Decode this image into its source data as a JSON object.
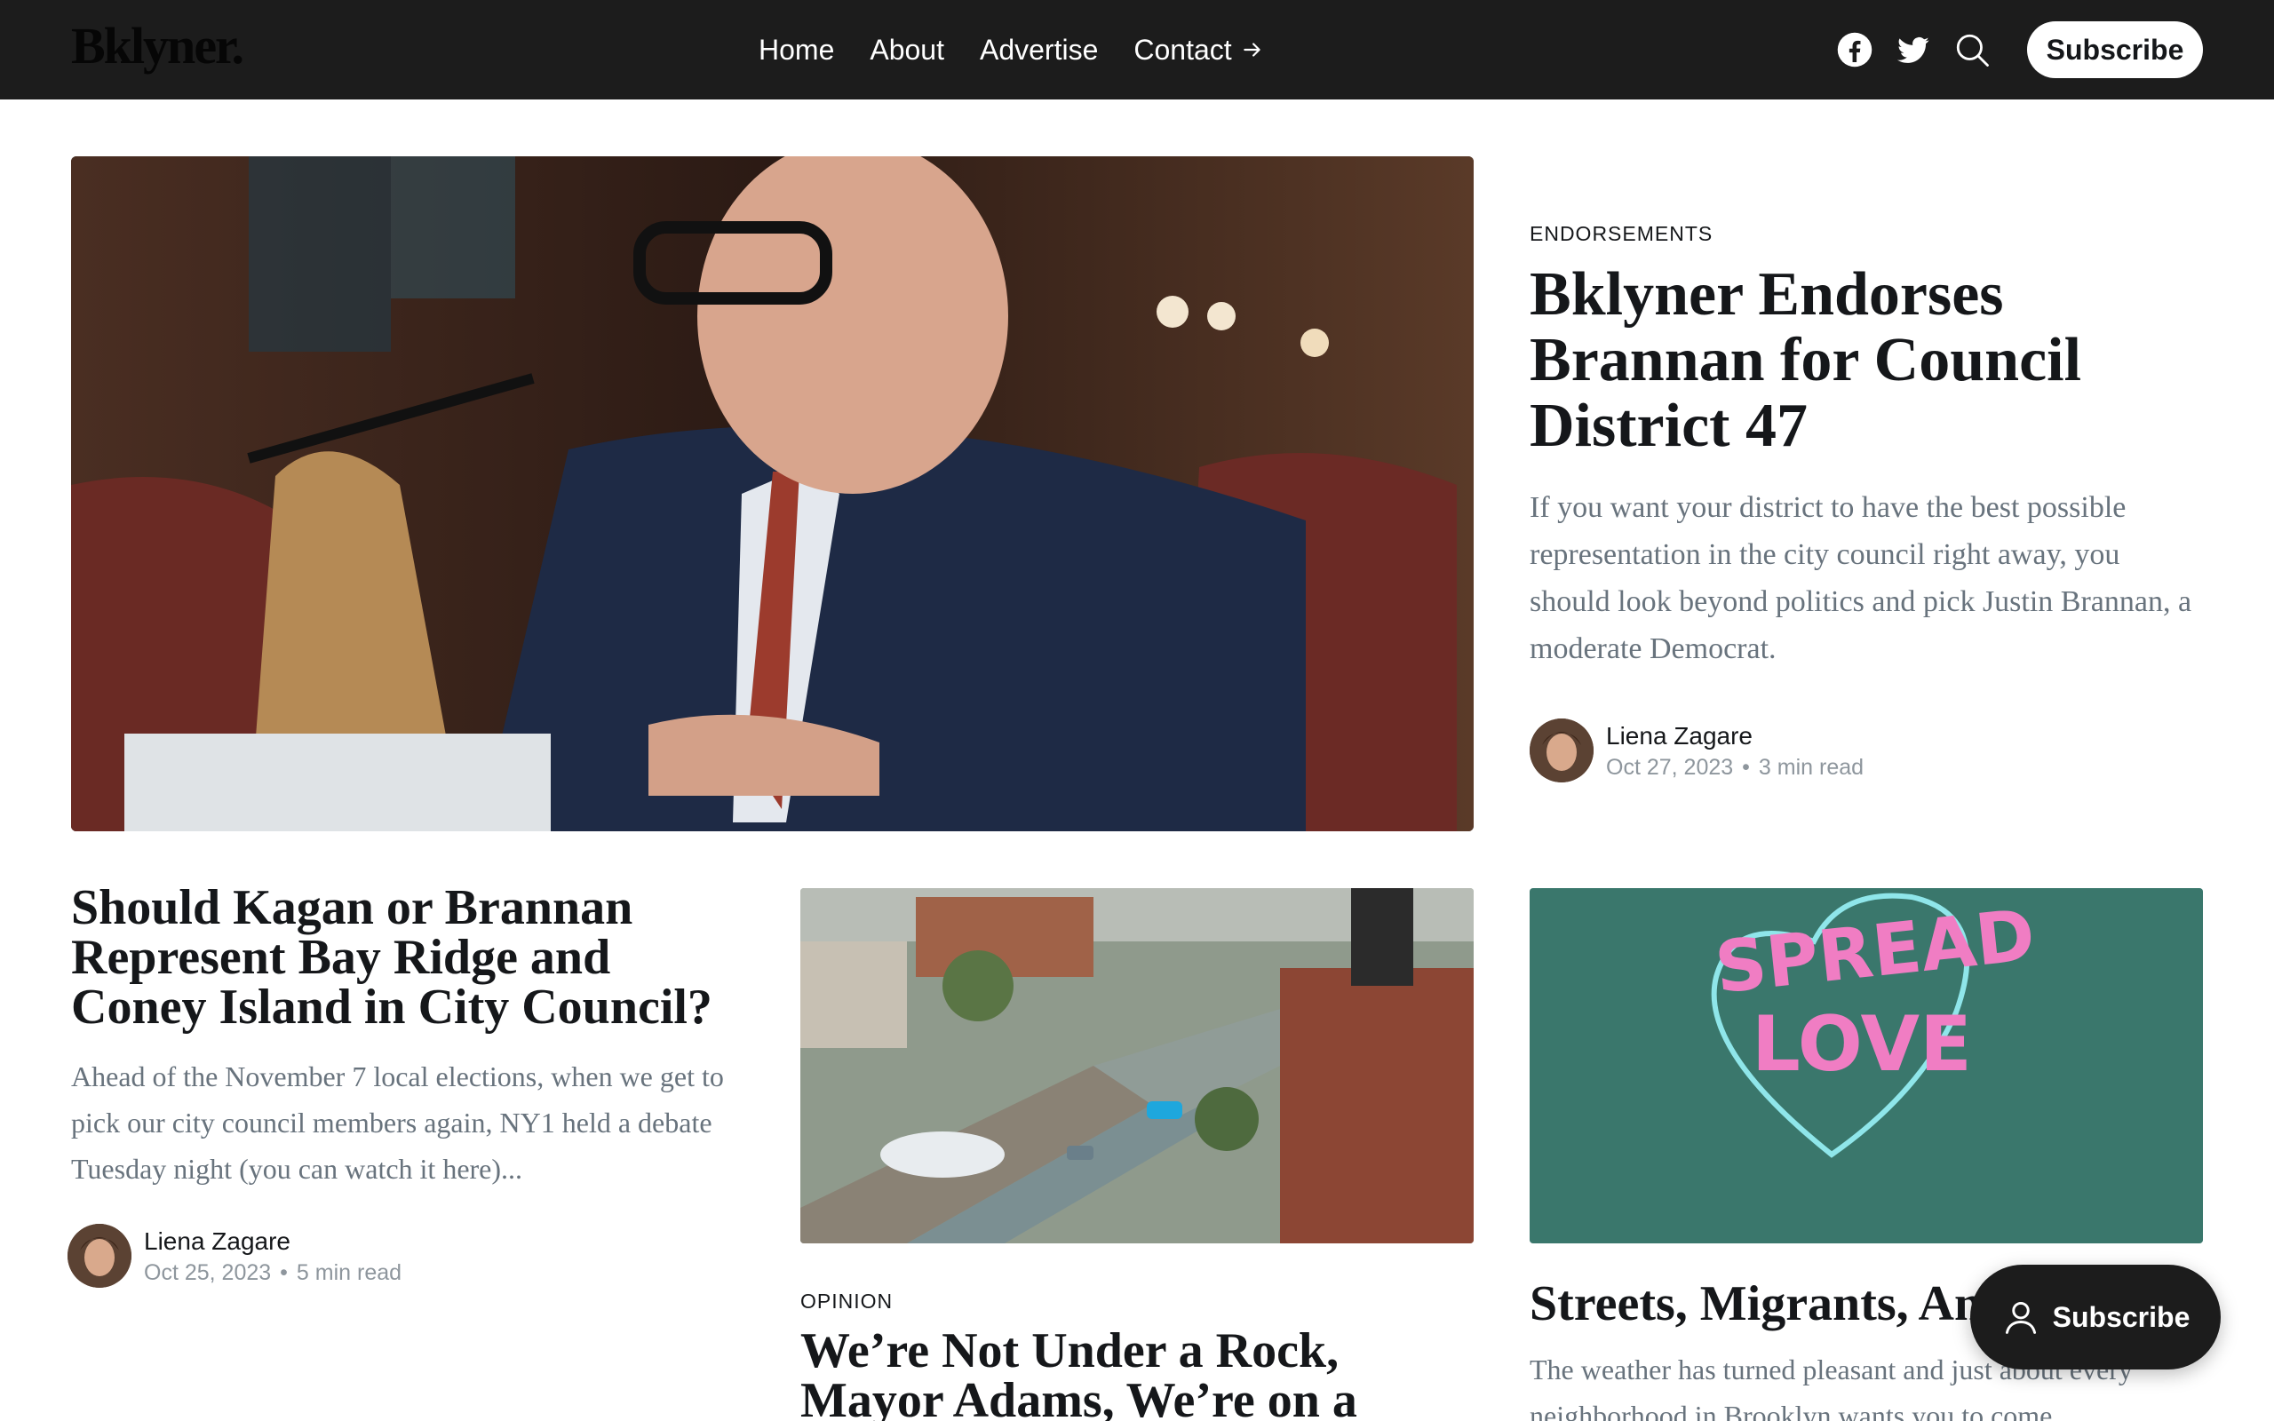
{
  "site": {
    "logo": "Bklyner."
  },
  "nav": [
    {
      "label": "Home"
    },
    {
      "label": "About"
    },
    {
      "label": "Advertise"
    },
    {
      "label": "Contact"
    }
  ],
  "header": {
    "subscribe_label": "Subscribe"
  },
  "icons": {
    "facebook": "facebook-icon",
    "twitter": "twitter-icon",
    "search": "search-icon",
    "arrow": "arrow-right-icon",
    "user": "user-icon"
  },
  "hero": {
    "tag": "ENDORSEMENTS",
    "title": "Bklyner Endorses Brannan for Council District 47",
    "excerpt": "If you want your district to have the best possible representation in the city council right away, you should look beyond politics and pick Justin Brannan, a moderate Democrat.",
    "author": "Liena Zagare",
    "date": "Oct 27, 2023",
    "read_time": "3 min read"
  },
  "cards": [
    {
      "title": "Should Kagan or Brannan Represent Bay Ridge and Coney Island in City Council?",
      "excerpt": "Ahead of the November 7 local elections, when we get to pick our city council members again, NY1 held a debate Tuesday night (you can watch it here)...",
      "author": "Liena Zagare",
      "date": "Oct 25, 2023",
      "read_time": "5 min read"
    },
    {
      "tag": "OPINION",
      "title": "We’re Not Under a Rock, Mayor Adams, We’re on a"
    },
    {
      "title": "Streets, Migrants, An",
      "excerpt": "The weather has turned pleasant and just about every neighborhood in Brooklyn wants you to come"
    }
  ],
  "floating": {
    "subscribe_label": "Subscribe"
  },
  "colors": {
    "header_bg": "#1c1c1c",
    "text": "#15171a",
    "muted": "#68737d",
    "meta": "#8e969d"
  }
}
